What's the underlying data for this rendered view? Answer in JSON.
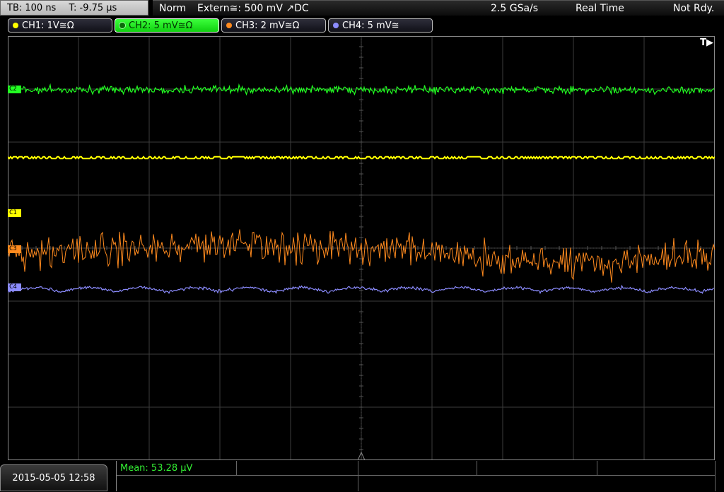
{
  "timebase": {
    "tb": "TB: 100 ns",
    "t": "T: -9.75 µs"
  },
  "status": {
    "mode": "Norm",
    "trigger": "Extern≅: 500 mV ↗DC",
    "sample_rate": "2.5 GSa/s",
    "acq_mode": "Real Time",
    "state": "Not Rdy."
  },
  "channels": [
    {
      "label": "CH1: 1V≅Ω",
      "color": "#ffff00"
    },
    {
      "label": "CH2: 5 mV≅Ω",
      "color": "#22ff22"
    },
    {
      "label": "CH3: 2 mV≅Ω",
      "color": "#ff8a1e"
    },
    {
      "label": "CH4: 5 mV≅",
      "color": "#8c8cff"
    }
  ],
  "markers": {
    "c1": "C1",
    "c2": "C2",
    "c3": "C3",
    "c4": "C4"
  },
  "trigger_indicator": "T▶",
  "datetime": "2015-05-05 12:58",
  "measurement": {
    "mean": "Mean: 53.28 µV"
  }
}
